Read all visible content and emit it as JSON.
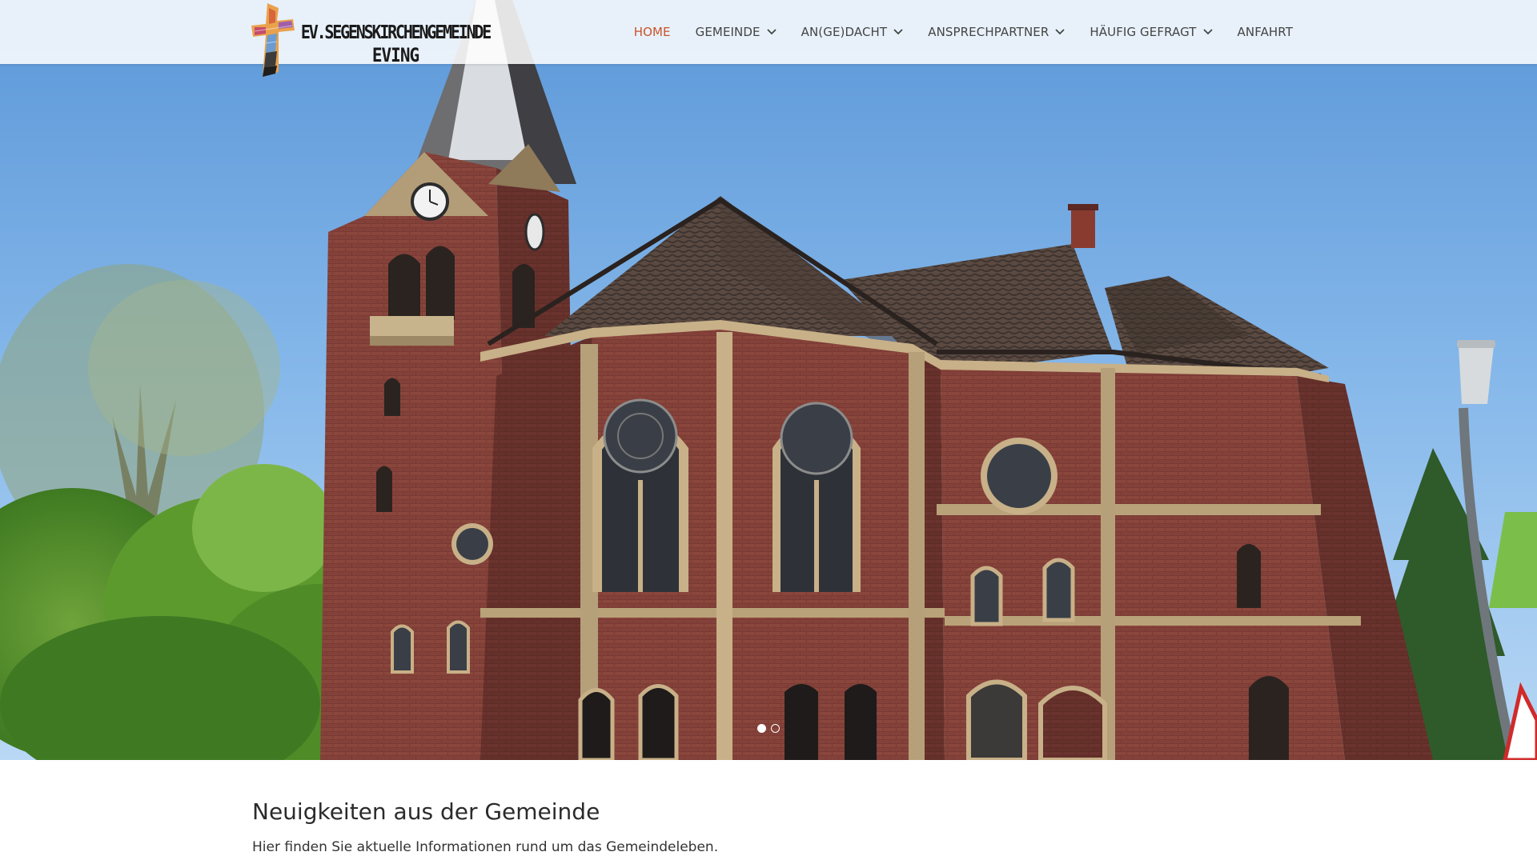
{
  "site": {
    "logo": {
      "line1": "EV.SEGENSKIRCHENGEMEINDE",
      "line2": "EVING",
      "icon": "stylized-cross-logo-icon"
    }
  },
  "nav": {
    "items": [
      {
        "label": "HOME",
        "active": true,
        "has_dropdown": false
      },
      {
        "label": "GEMEINDE",
        "active": false,
        "has_dropdown": true
      },
      {
        "label": "AN(GE)DACHT",
        "active": false,
        "has_dropdown": true
      },
      {
        "label": "ANSPRECHPARTNER",
        "active": false,
        "has_dropdown": true
      },
      {
        "label": "HÄUFIG GEFRAGT",
        "active": false,
        "has_dropdown": true
      },
      {
        "label": "ANFAHRT",
        "active": false,
        "has_dropdown": false
      }
    ],
    "active_color": "#c9532a",
    "dropdown_icon": "chevron-down-icon"
  },
  "hero": {
    "slides_total": 2,
    "active_slide": 1
  },
  "news": {
    "title": "Neuigkeiten aus der Gemeinde",
    "subtitle": "Hier finden Sie aktuelle Informationen rund um das Gemeindeleben."
  }
}
